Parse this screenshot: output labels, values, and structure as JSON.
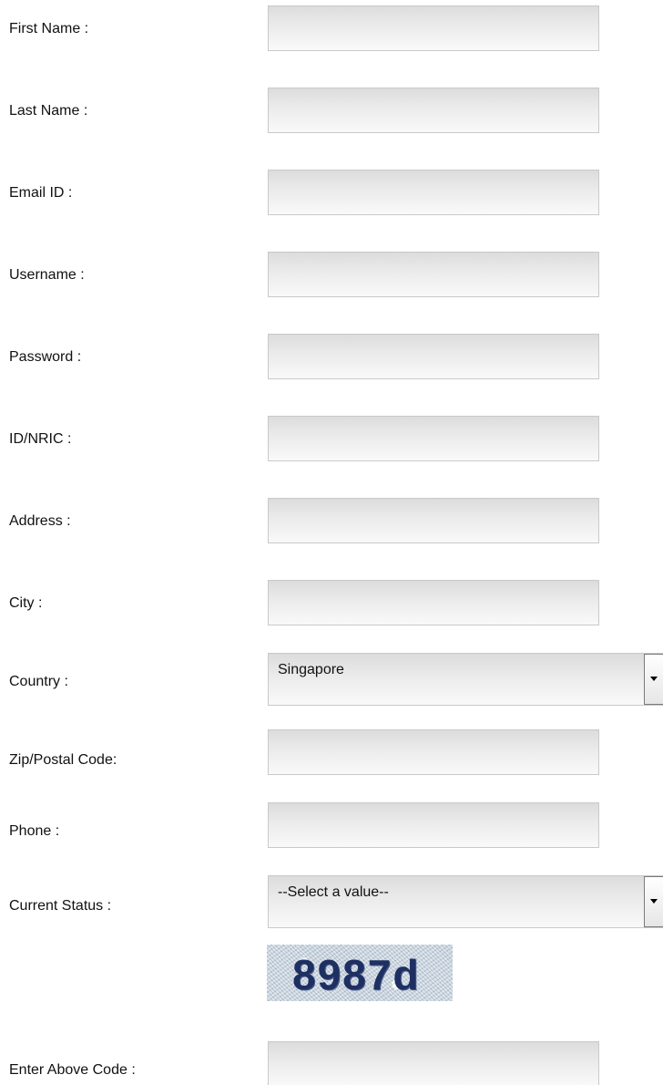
{
  "form": {
    "first_name": {
      "label": "First Name :",
      "value": ""
    },
    "last_name": {
      "label": "Last Name :",
      "value": ""
    },
    "email": {
      "label": "Email ID :",
      "value": ""
    },
    "username": {
      "label": "Username :",
      "value": ""
    },
    "password": {
      "label": "Password :",
      "value": ""
    },
    "id_nric": {
      "label": "ID/NRIC :",
      "value": ""
    },
    "address": {
      "label": "Address :",
      "value": ""
    },
    "city": {
      "label": "City :",
      "value": ""
    },
    "country": {
      "label": "Country :",
      "selected": "Singapore",
      "icon": "chevron-down-icon"
    },
    "zip": {
      "label": "Zip/Postal Code:",
      "value": ""
    },
    "phone": {
      "label": "Phone :",
      "value": ""
    },
    "current_status": {
      "label": "Current Status :",
      "selected": "--Select a value--",
      "icon": "chevron-down-icon"
    },
    "captcha": {
      "code": "8987d"
    },
    "captcha_input": {
      "label": "Enter Above Code :",
      "value": ""
    }
  },
  "colors": {
    "field_gradient_top": "#dcdcdc",
    "field_gradient_bottom": "#f9f9f9",
    "field_border": "#c9c9c9",
    "captcha_text": "#1e2f62",
    "captcha_bg": "#c9d4de"
  }
}
